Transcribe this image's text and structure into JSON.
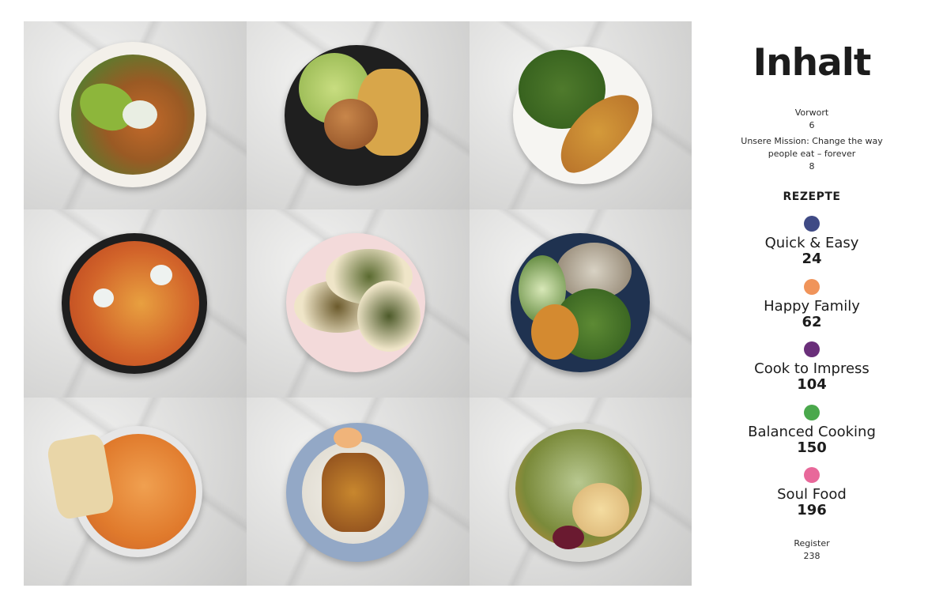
{
  "toc": {
    "title": "Inhalt",
    "intro": [
      {
        "label": "Vorwort",
        "page": "6"
      },
      {
        "label_line1": "Unsere Mission: Change the way",
        "label_line2": "people eat – forever",
        "page": "8"
      }
    ],
    "section_heading": "REZEPTE",
    "categories": [
      {
        "name": "Quick & Easy",
        "page": "24",
        "color": "#3f4a85"
      },
      {
        "name": "Happy Family",
        "page": "62",
        "color": "#f0945a"
      },
      {
        "name": "Cook to Impress",
        "page": "104",
        "color": "#6a2f7a"
      },
      {
        "name": "Balanced Cooking",
        "page": "150",
        "color": "#4aa84c"
      },
      {
        "name": "Soul Food",
        "page": "196",
        "color": "#e8689a"
      }
    ],
    "register": {
      "label": "Register",
      "page": "238"
    }
  },
  "photos": [
    {
      "name": "dish-sweet-potato-salad-bowl"
    },
    {
      "name": "dish-burger-with-wedges"
    },
    {
      "name": "dish-flatbread-with-salad"
    },
    {
      "name": "dish-spaghetti-tomato-bowl"
    },
    {
      "name": "dish-bean-tacos"
    },
    {
      "name": "dish-rice-bowl-broccoli"
    },
    {
      "name": "dish-curry-soup-with-flatbread"
    },
    {
      "name": "dish-crispy-fish-rice-plate"
    },
    {
      "name": "dish-salad-with-camembert"
    }
  ]
}
